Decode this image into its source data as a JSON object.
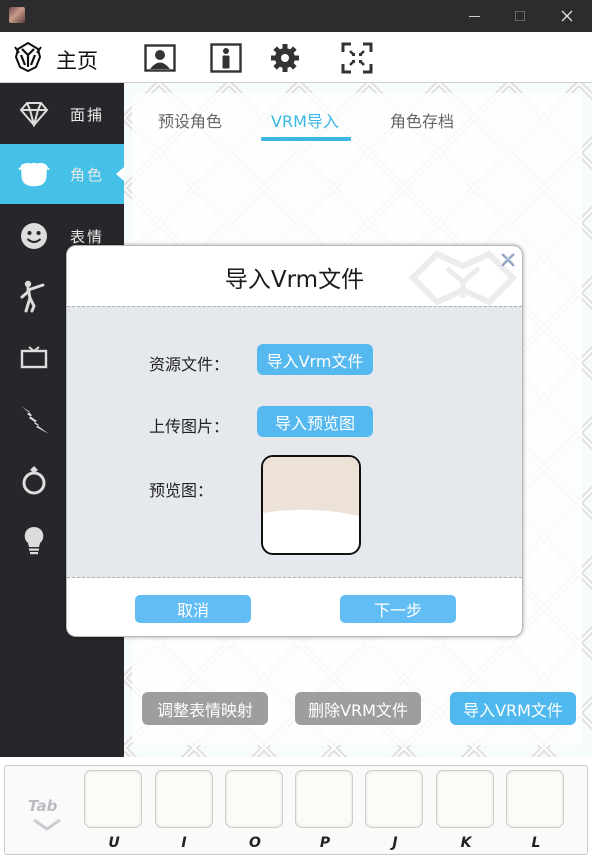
{
  "window": {
    "minimize_icon": "minimize-icon",
    "maximize_icon": "maximize-icon",
    "close_icon": "close-icon"
  },
  "header": {
    "title": "主页",
    "icons": [
      "portrait-icon",
      "info-person-icon",
      "gear-icon",
      "focus-frame-icon"
    ]
  },
  "sidebar": {
    "items": [
      {
        "icon": "diamond-icon",
        "label": "面捕"
      },
      {
        "icon": "character-icon",
        "label": "角色"
      },
      {
        "icon": "smiley-icon",
        "label": "表情"
      },
      {
        "icon": "dance-pose-icon",
        "label": ""
      },
      {
        "icon": "screen-icon",
        "label": ""
      },
      {
        "icon": "lightning-icon",
        "label": ""
      },
      {
        "icon": "ring-icon",
        "label": ""
      },
      {
        "icon": "lightbulb-icon",
        "label": ""
      }
    ],
    "active_index": 1
  },
  "tabs": {
    "items": [
      "预设角色",
      "VRM导入",
      "角色存档"
    ],
    "active_index": 1
  },
  "actions": {
    "adjust_expression": "调整表情映射",
    "delete_vrm": "删除VRM文件",
    "import_vrm": "导入VRM文件"
  },
  "dialog": {
    "title": "导入Vrm文件",
    "resource_label": "资源文件：",
    "resource_button": "导入Vrm文件",
    "upload_label": "上传图片：",
    "upload_button": "导入预览图",
    "preview_label": "预览图：",
    "cancel": "取消",
    "next": "下一步"
  },
  "hotkeys": {
    "tab_hint": "Tab",
    "keys": [
      "U",
      "I",
      "O",
      "P",
      "J",
      "K",
      "L"
    ]
  },
  "colors": {
    "accent": "#45c0e6",
    "button_blue": "#4fb9ef",
    "button_grey": "#9e9e9e",
    "sidebar_bg": "#27272b"
  }
}
